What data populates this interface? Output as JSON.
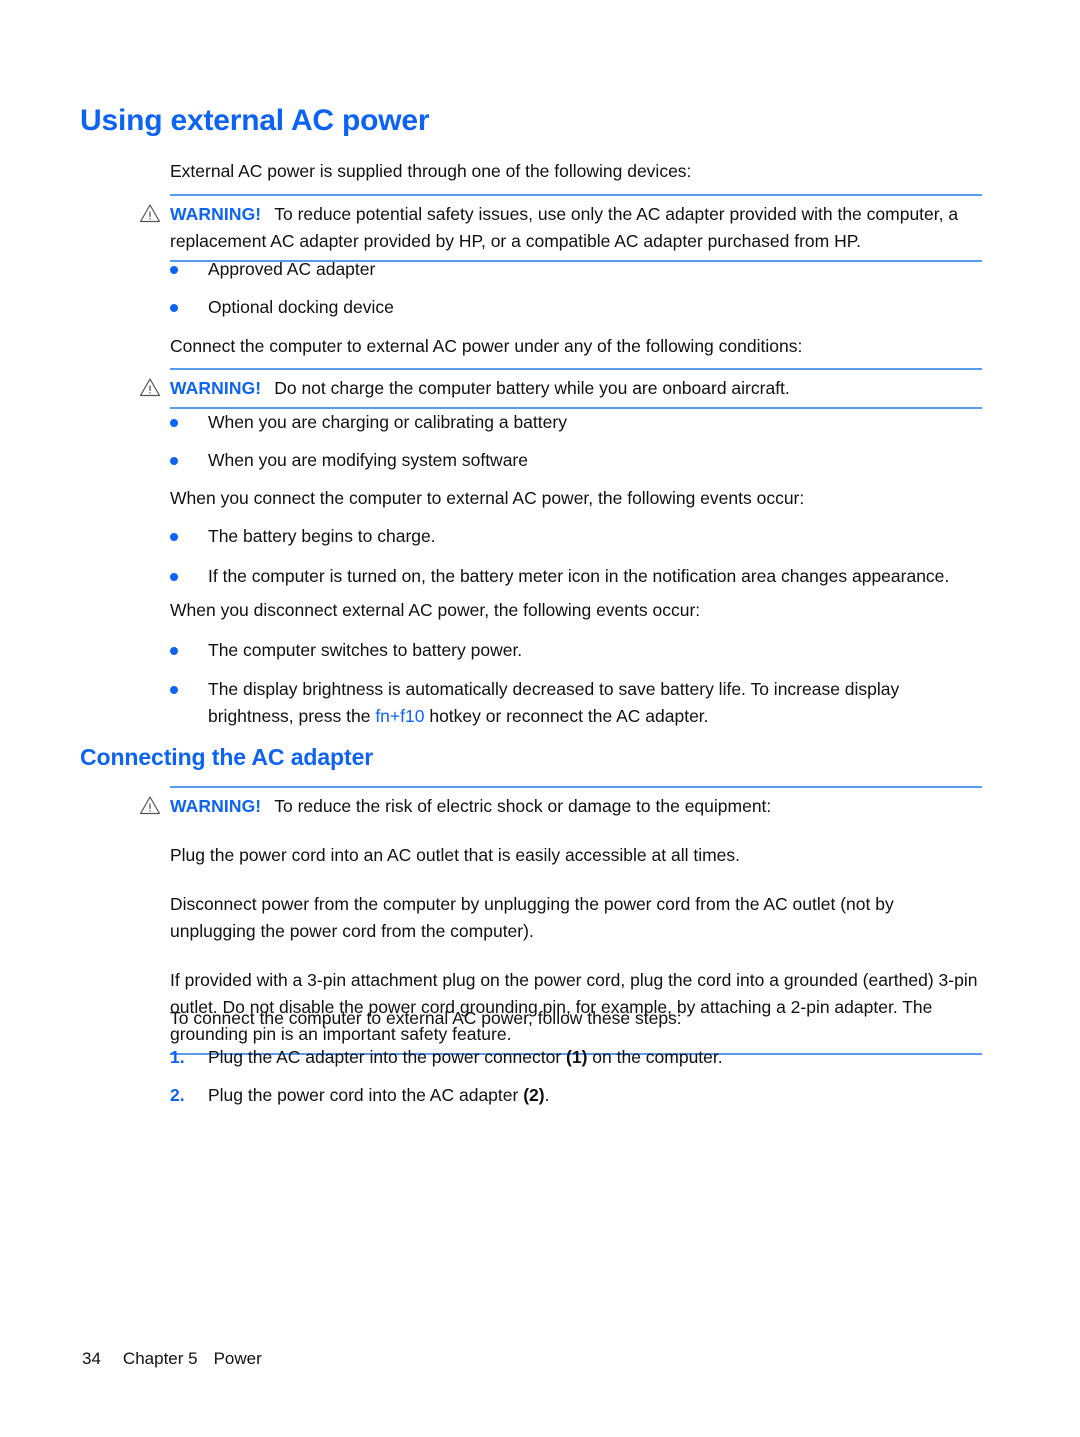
{
  "document": {
    "title": "Using external AC power",
    "section_heading": "Connecting the AC adapter"
  },
  "colors": {
    "heading_blue": "#0d63f3",
    "rule_blue": "#5b9bed",
    "bullet_blue": "#0d63f3",
    "body_black": "#111111"
  },
  "intro": {
    "paragraph": "External AC power is supplied through one of the following devices:"
  },
  "warning_1": {
    "icon": "warning-triangle-icon",
    "label": "WARNING!",
    "text": "To reduce potential safety issues, use only the AC adapter provided with the computer, a replacement AC adapter provided by HP, or a compatible AC adapter purchased from HP."
  },
  "devices_list": [
    "Approved AC adapter",
    "Optional docking device"
  ],
  "conditions_intro": "Connect the computer to external AC power under any of the following conditions:",
  "warning_2": {
    "icon": "warning-triangle-icon",
    "label": "WARNING!",
    "text": "Do not charge the computer battery while you are onboard aircraft."
  },
  "conditions_list": [
    "When you are charging or calibrating a battery",
    "When you are modifying system software"
  ],
  "connect_events_intro": "When you connect the computer to external AC power, the following events occur:",
  "connect_events_list": [
    "The battery begins to charge.",
    "If the computer is turned on, the battery meter icon in the notification area changes appearance."
  ],
  "disconnect_events_intro": "When you disconnect external AC power, the following events occur:",
  "disconnect_events_list": [
    "The computer switches to battery power."
  ],
  "brightness_item": {
    "text_before": "The display brightness is automatically decreased to save battery life. To increase display brightness, press the ",
    "hotkey": "fn+f10",
    "text_after": " hotkey or reconnect the AC adapter."
  },
  "warning_3": {
    "icon": "warning-triangle-icon",
    "label": "WARNING!",
    "text": "To reduce the risk of electric shock or damage to the equipment:",
    "paragraphs": [
      "Plug the power cord into an AC outlet that is easily accessible at all times.",
      "Disconnect power from the computer by unplugging the power cord from the AC outlet (not by unplugging the power cord from the computer).",
      "If provided with a 3-pin attachment plug on the power cord, plug the cord into a grounded (earthed) 3-pin outlet. Do not disable the power cord grounding pin, for example, by attaching a 2-pin adapter. The grounding pin is an important safety feature."
    ]
  },
  "steps_intro": "To connect the computer to external AC power, follow these steps:",
  "steps": [
    {
      "number": "1.",
      "text_before": "Plug the AC adapter into the power connector ",
      "callout": "(1)",
      "text_after": " on the computer."
    },
    {
      "number": "2.",
      "text_before": "Plug the power cord into the AC adapter ",
      "callout": "(2)",
      "text_after": "."
    }
  ],
  "footer": {
    "page_number": "34",
    "chapter": "Chapter 5",
    "chapter_title": "Power"
  }
}
